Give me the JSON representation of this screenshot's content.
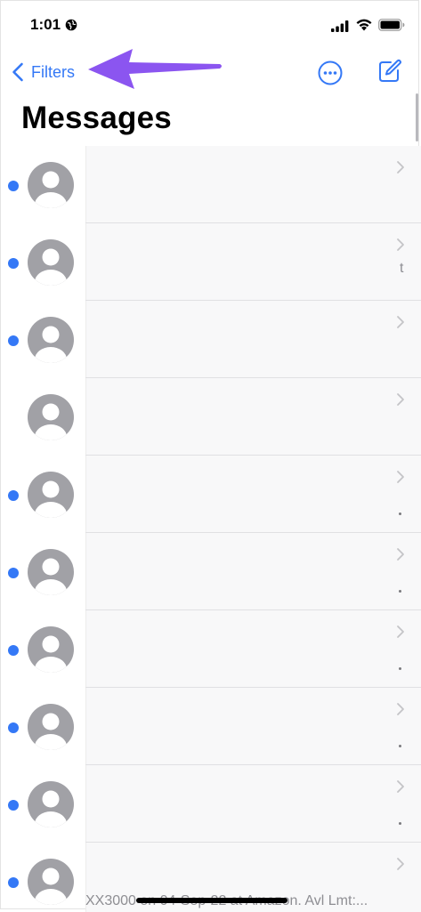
{
  "status_bar": {
    "time": "1:01",
    "icons": [
      "globe-icon",
      "signal-icon",
      "wifi-icon",
      "battery-icon"
    ]
  },
  "nav": {
    "back_label": "Filters",
    "back_icon": "chevron-left-icon",
    "more_icon": "ellipsis-circle-icon",
    "compose_icon": "compose-icon"
  },
  "title": "Messages",
  "colors": {
    "accent": "#3478f6",
    "annotation_arrow": "#8b55f0",
    "avatar": "#a1a1a6"
  },
  "conversations": [
    {
      "unread": true,
      "preview_fragment": ""
    },
    {
      "unread": true,
      "preview_fragment": "t"
    },
    {
      "unread": true,
      "preview_fragment": ""
    },
    {
      "unread": false,
      "preview_fragment": ""
    },
    {
      "unread": true,
      "preview_fragment": ""
    },
    {
      "unread": true,
      "preview_fragment": ""
    },
    {
      "unread": true,
      "preview_fragment": ""
    },
    {
      "unread": true,
      "preview_fragment": ""
    },
    {
      "unread": true,
      "preview_fragment": ""
    },
    {
      "unread": true,
      "preview_fragment": ""
    }
  ],
  "bottom_preview_text": "XX3000 on 04-Sep-22 at Amazon. Avl Lmt:..."
}
